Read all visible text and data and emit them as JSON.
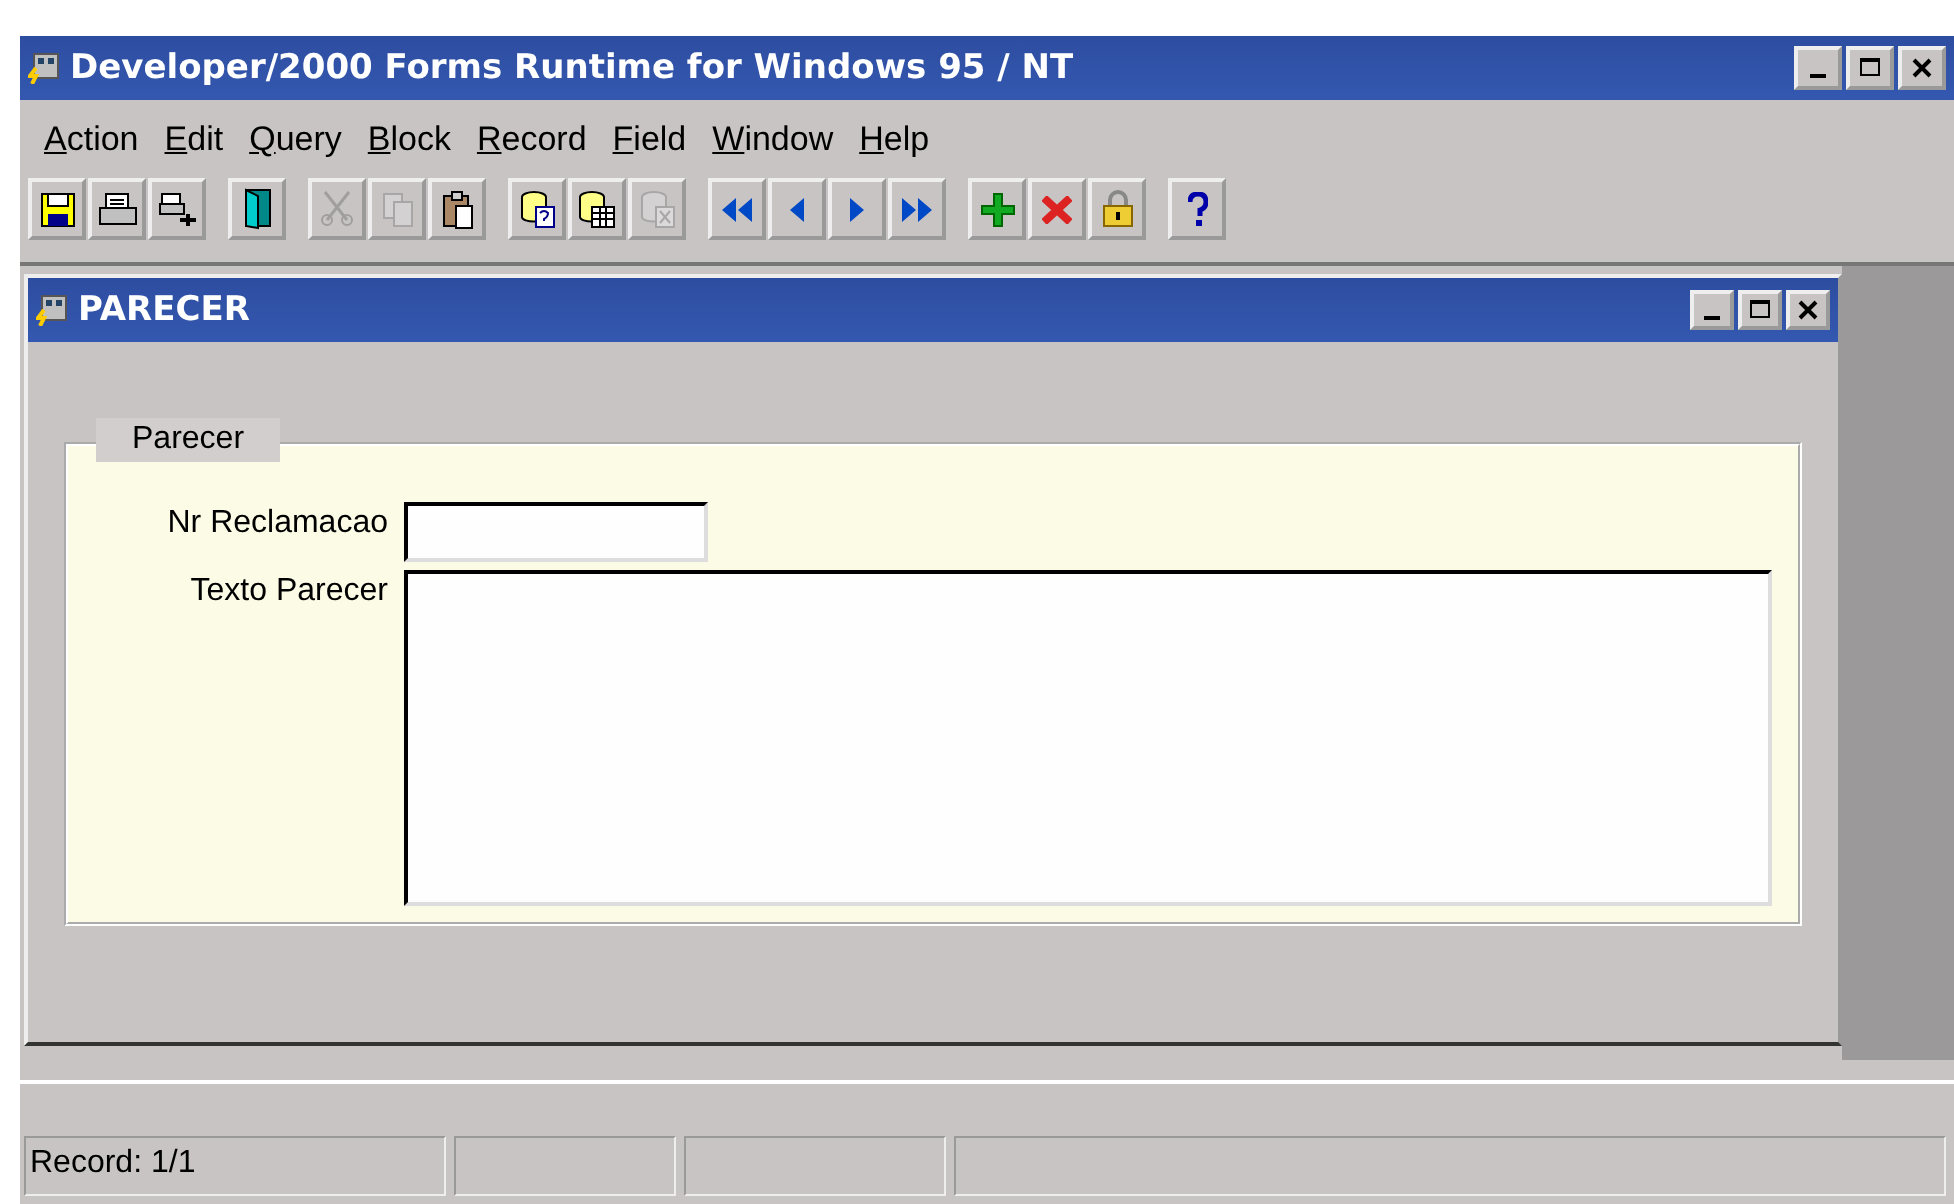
{
  "window": {
    "title": "Developer/2000 Forms Runtime for Windows 95 / NT"
  },
  "menu": [
    {
      "label": "Action"
    },
    {
      "label": "Edit"
    },
    {
      "label": "Query"
    },
    {
      "label": "Block"
    },
    {
      "label": "Record"
    },
    {
      "label": "Field"
    },
    {
      "label": "Window"
    },
    {
      "label": "Help"
    }
  ],
  "toolbar": [
    {
      "buttons": [
        {
          "kind": "save",
          "disabled": false
        },
        {
          "kind": "print",
          "disabled": false
        },
        {
          "kind": "printsetup",
          "disabled": false
        }
      ]
    },
    {
      "buttons": [
        {
          "kind": "exit",
          "disabled": false
        }
      ]
    },
    {
      "buttons": [
        {
          "kind": "cut",
          "disabled": true
        },
        {
          "kind": "copy",
          "disabled": true
        },
        {
          "kind": "paste",
          "disabled": false
        }
      ]
    },
    {
      "buttons": [
        {
          "kind": "enterquery",
          "disabled": false
        },
        {
          "kind": "executequery",
          "disabled": false
        },
        {
          "kind": "cancelquery",
          "disabled": true
        }
      ]
    },
    {
      "buttons": [
        {
          "kind": "first",
          "disabled": false
        },
        {
          "kind": "prev",
          "disabled": false
        },
        {
          "kind": "next",
          "disabled": false
        },
        {
          "kind": "last",
          "disabled": false
        }
      ]
    },
    {
      "buttons": [
        {
          "kind": "insert",
          "disabled": false
        },
        {
          "kind": "delete",
          "disabled": false
        },
        {
          "kind": "lock",
          "disabled": false
        }
      ]
    },
    {
      "buttons": [
        {
          "kind": "help",
          "disabled": false
        }
      ]
    }
  ],
  "form_window": {
    "title": "PARECER",
    "frame": {
      "title": "Parecer",
      "fields": [
        {
          "label": "Nr Reclamacao",
          "kind": "text"
        },
        {
          "label": "Texto Parecer",
          "kind": "multiline"
        }
      ]
    }
  },
  "status_bar": {
    "cells": [
      "Record: 1/1",
      "",
      "",
      ""
    ]
  }
}
